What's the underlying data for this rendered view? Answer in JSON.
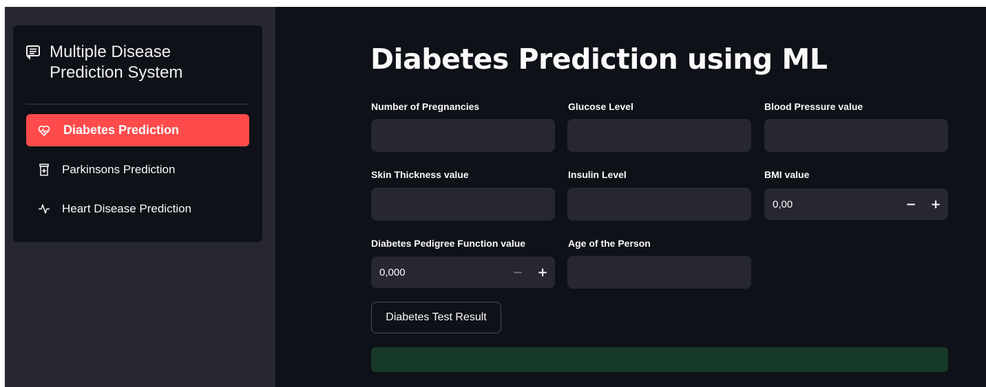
{
  "sidebar": {
    "title": "Multiple Disease Prediction System",
    "title_line1": "Multiple Disease",
    "title_line2": "Prediction System",
    "items": [
      {
        "label": "Diabetes Prediction",
        "icon": "activity-heart-icon",
        "active": true
      },
      {
        "label": "Parkinsons Prediction",
        "icon": "prescription-icon",
        "active": false
      },
      {
        "label": "Heart Disease Prediction",
        "icon": "pulse-icon",
        "active": false
      }
    ]
  },
  "main": {
    "title": "Diabetes Prediction using ML",
    "fields": {
      "pregnancies": {
        "label": "Number of Pregnancies",
        "value": ""
      },
      "glucose": {
        "label": "Glucose Level",
        "value": ""
      },
      "blood_pressure": {
        "label": "Blood Pressure value",
        "value": ""
      },
      "skin_thickness": {
        "label": "Skin Thickness value",
        "value": ""
      },
      "insulin": {
        "label": "Insulin Level",
        "value": ""
      },
      "bmi": {
        "label": "BMI value",
        "value": "0,00"
      },
      "pedigree": {
        "label": "Diabetes Pedigree Function value",
        "value": "0,000"
      },
      "age": {
        "label": "Age of the Person",
        "value": ""
      }
    },
    "stepper": {
      "minus": "−",
      "plus": "+"
    },
    "submit_label": "Diabetes Test Result",
    "result_text": ""
  },
  "colors": {
    "accent": "#ff4b4b",
    "sidebar_bg": "#262730",
    "main_bg": "#0e1117",
    "input_bg": "#262730",
    "result_bg": "#173928"
  }
}
